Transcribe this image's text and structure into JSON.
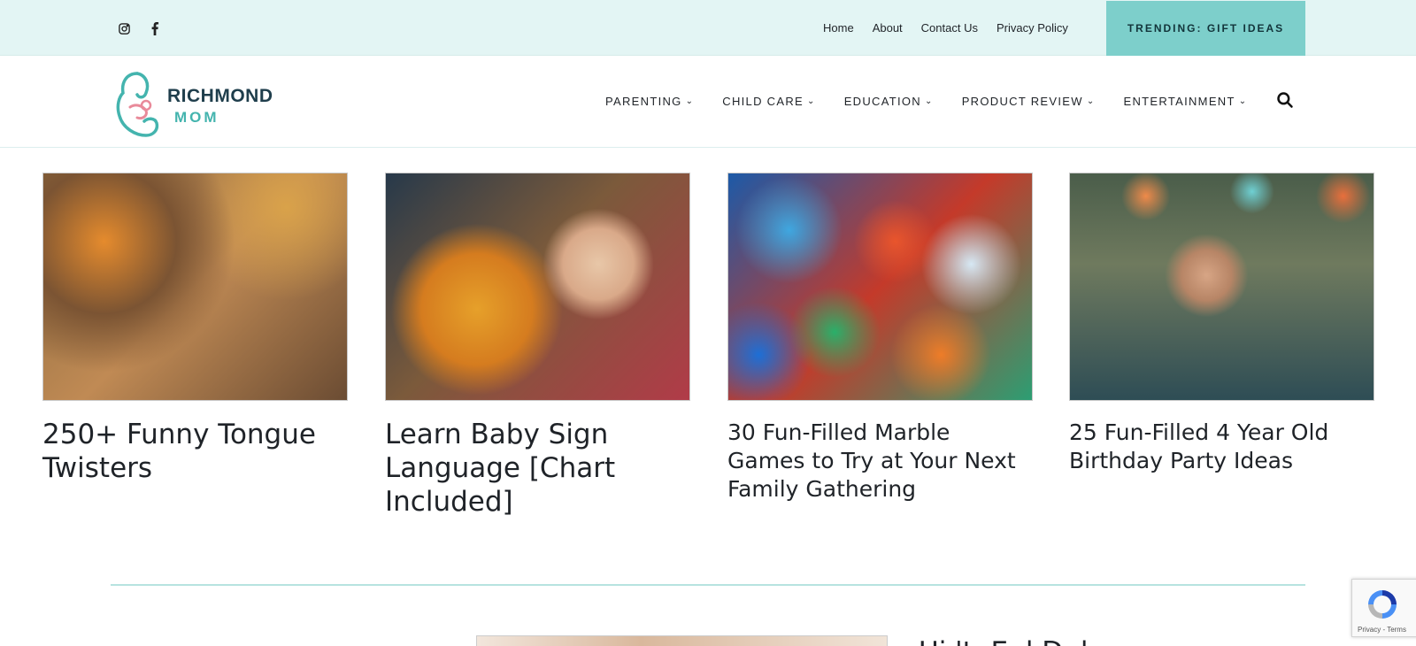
{
  "topbar": {
    "social": [
      {
        "icon": "instagram-icon"
      },
      {
        "icon": "facebook-icon"
      }
    ],
    "links": [
      "Home",
      "About",
      "Contact Us",
      "Privacy Policy"
    ],
    "trending_label": "TRENDING: GIFT IDEAS"
  },
  "header": {
    "logo_line1": "RICHMOND",
    "logo_line2": "MOM",
    "nav": [
      "PARENTING",
      "CHILD CARE",
      "EDUCATION",
      "PRODUCT REVIEW",
      "ENTERTAINMENT"
    ],
    "chevron": "⌄"
  },
  "cards": [
    {
      "title": "250+ Funny Tongue Twisters"
    },
    {
      "title": "Learn Baby Sign Language [Chart Included]"
    },
    {
      "title": "30 Fun-Filled Marble Games to Try at Your Next Family Gathering"
    },
    {
      "title": "25 Fun-Filled 4 Year Old Birthday Party Ideas"
    }
  ],
  "next_article": {
    "title_partial": "Ui·'t· E ·l D ·l"
  },
  "recaptcha": {
    "text": "Privacy - Terms"
  },
  "colors": {
    "accent": "#7dcfcb",
    "topbar_bg": "#e3f5f4",
    "divider": "#b7e3e0",
    "logo_dark": "#1f3e4c",
    "logo_teal": "#44b4ae"
  }
}
